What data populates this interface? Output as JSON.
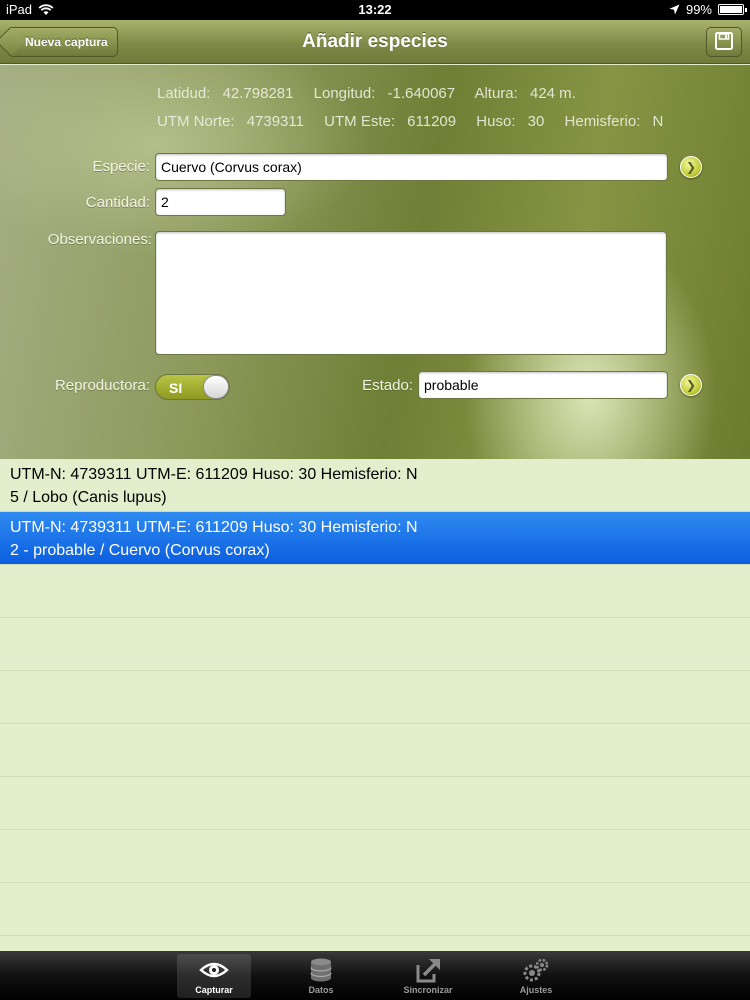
{
  "status_bar": {
    "carrier": "iPad",
    "time": "13:22",
    "battery": "99%",
    "battery_level": 0.99
  },
  "nav": {
    "back_label": "Nueva captura",
    "title": "Añadir especies"
  },
  "coords": {
    "lat_label": "Latidud:",
    "lat": "42.798281",
    "lon_label": "Longitud:",
    "lon": "-1.640067",
    "alt_label": "Altura:",
    "alt": "424 m.",
    "utm_n_label": "UTM Norte:",
    "utm_n": "4739311",
    "utm_e_label": "UTM Este:",
    "utm_e": "611209",
    "huso_label": "Huso:",
    "huso": "30",
    "hemi_label": "Hemisferio:",
    "hemi": "N"
  },
  "form": {
    "especie_label": "Especie:",
    "especie_value": "Cuervo (Corvus corax)",
    "cantidad_label": "Cantidad:",
    "cantidad_value": "2",
    "observaciones_label": "Observaciones:",
    "observaciones_value": "",
    "reproductora_label": "Reproductora:",
    "reproductora_value": "SI",
    "estado_label": "Estado:",
    "estado_value": "probable"
  },
  "list": {
    "rows": [
      {
        "line1": "UTM-N: 4739311 UTM-E: 611209 Huso: 30 Hemisferio: N",
        "line2": "5 / Lobo (Canis lupus)",
        "selected": false
      },
      {
        "line1": "UTM-N: 4739311 UTM-E: 611209 Huso: 30 Hemisferio: N",
        "line2": "2 - probable / Cuervo (Corvus corax)",
        "selected": true
      }
    ]
  },
  "tabs": [
    {
      "label": "Capturar",
      "icon": "eye-icon",
      "active": true
    },
    {
      "label": "Datos",
      "icon": "database-icon",
      "active": false
    },
    {
      "label": "Sincronizar",
      "icon": "sync-arrow-icon",
      "active": false
    },
    {
      "label": "Ajustes",
      "icon": "gears-icon",
      "active": false
    }
  ]
}
